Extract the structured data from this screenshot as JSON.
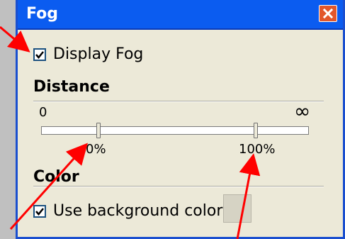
{
  "window": {
    "title": "Fog",
    "close_glyph": "×"
  },
  "display_fog": {
    "label": "Display Fog",
    "checked": true
  },
  "distance": {
    "title": "Distance",
    "min_label": "0",
    "max_label": "∞",
    "near_value_label": "0%",
    "far_value_label": "100%",
    "near_value": 0,
    "far_value": 100
  },
  "color": {
    "title": "Color",
    "use_background_label": "Use background color",
    "use_background_checked": true,
    "swatch_color": "#d6d3c4"
  },
  "annotation_arrow_color": "#ff0000"
}
